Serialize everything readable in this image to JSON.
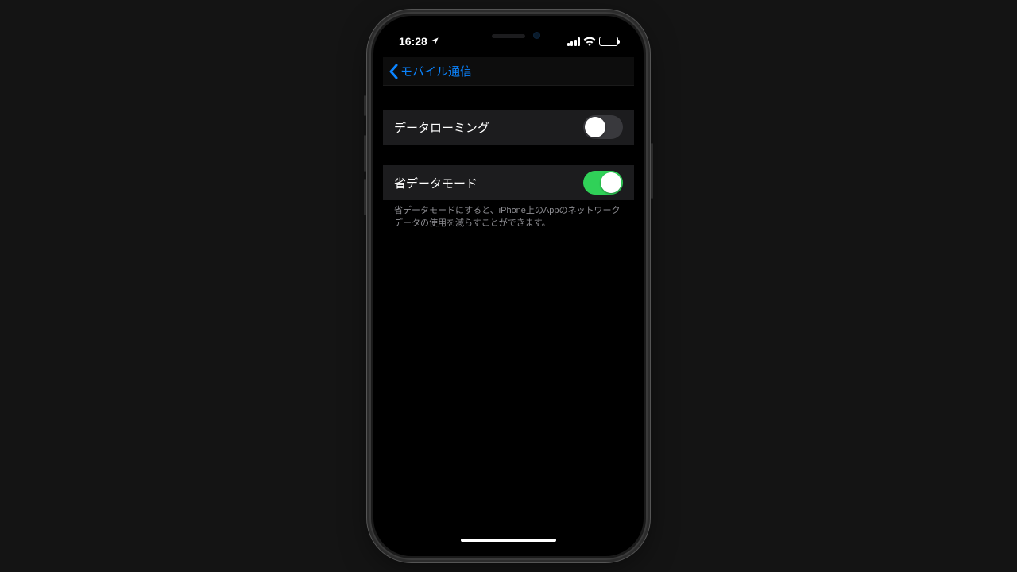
{
  "status": {
    "time": "16:28"
  },
  "nav": {
    "back_label": "モバイル通信"
  },
  "cells": {
    "data_roaming": {
      "label": "データローミング",
      "on": false
    },
    "low_data": {
      "label": "省データモード",
      "on": true
    }
  },
  "footer": "省データモードにすると、iPhone上のAppのネットワークデータの使用を減らすことができます。",
  "colors": {
    "accent": "#0b84ff",
    "toggle_on": "#30d158"
  }
}
